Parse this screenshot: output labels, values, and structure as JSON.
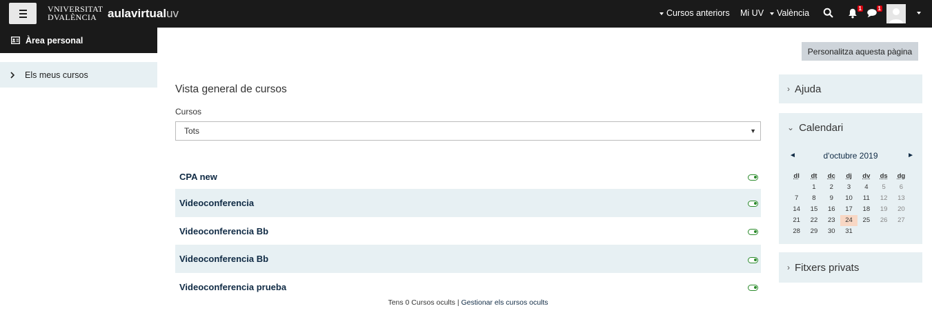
{
  "navbar": {
    "uv_logo_line1": "VNIVERSITAT",
    "uv_logo_line2": "DVALÈNCIA",
    "aula_bold": "aula",
    "aula_mid": "virtual",
    "aula_light": "uv",
    "cursos_anteriors": "Cursos anteriors",
    "mi_uv": "Mi UV",
    "valencia": "València",
    "notifications_count": "1",
    "messages_count": "1"
  },
  "drawer": {
    "header": "Àrea personal",
    "items": [
      {
        "label": "Els meus cursos"
      }
    ]
  },
  "main": {
    "personalize_button": "Personalitza aquesta pàgina",
    "title": "Vista general de cursos",
    "filter_label": "Cursos",
    "filter_value": "Tots",
    "courses": [
      {
        "name": "CPA new"
      },
      {
        "name": "Videoconferencia"
      },
      {
        "name": "Videoconferencia Bb"
      },
      {
        "name": "Videoconferencia Bb"
      },
      {
        "name": "Videoconferencia prueba"
      }
    ],
    "hidden_text": "Tens 0 Cursos ocults | ",
    "hidden_link": "Gestionar els cursos ocults"
  },
  "blocks": {
    "help": "Ajuda",
    "calendar": "Calendari",
    "private_files": "Fitxers privats"
  },
  "calendar": {
    "month": "d'octubre 2019",
    "prev": "◄",
    "next": "►",
    "weekdays": [
      "dl",
      "dt",
      "dc",
      "dj",
      "dv",
      "ds",
      "dg"
    ],
    "weeks": [
      [
        "",
        "1",
        "2",
        "3",
        "4",
        "5",
        "6"
      ],
      [
        "7",
        "8",
        "9",
        "10",
        "11",
        "12",
        "13"
      ],
      [
        "14",
        "15",
        "16",
        "17",
        "18",
        "19",
        "20"
      ],
      [
        "21",
        "22",
        "23",
        "24",
        "25",
        "26",
        "27"
      ],
      [
        "28",
        "29",
        "30",
        "31",
        "",
        "",
        ""
      ]
    ],
    "today": "24"
  },
  "colors": {
    "navbar": "#1a1a1a",
    "highlight_row": "#e7f0f3",
    "link": "#0f2a44",
    "toggle_on": "#2a8a2a",
    "badge": "#d9000d",
    "today": "#f8d7c4"
  }
}
